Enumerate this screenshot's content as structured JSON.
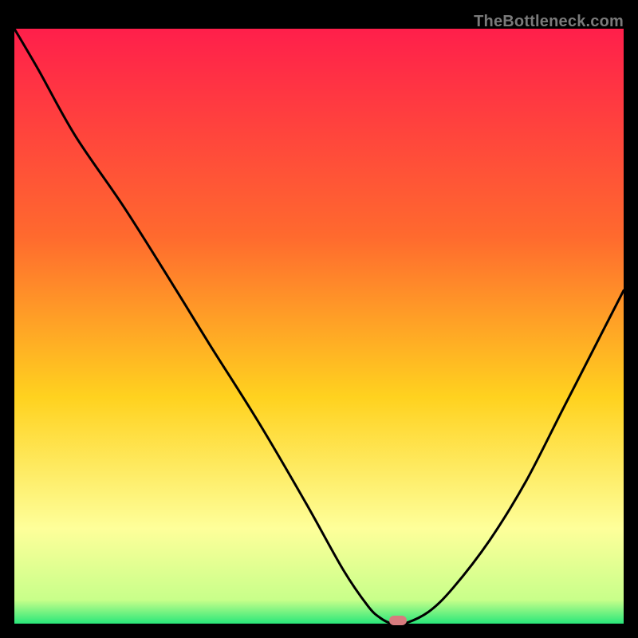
{
  "watermark": "TheBottleneck.com",
  "colors": {
    "top": "#ff1f4b",
    "mid1": "#ff6a2e",
    "mid2": "#ffd21f",
    "band": "#feff9a",
    "bottom": "#29e77a",
    "marker": "#d87b7e",
    "curve": "#000000",
    "frame": "#000000"
  },
  "chart_data": {
    "type": "line",
    "title": "",
    "xlabel": "",
    "ylabel": "",
    "xlim": [
      0,
      100
    ],
    "ylim": [
      0,
      100
    ],
    "series": [
      {
        "name": "bottleneck-curve",
        "x": [
          0,
          4,
          10,
          18,
          26,
          32,
          40,
          48,
          54,
          58,
          60,
          62,
          64,
          68,
          72,
          78,
          84,
          90,
          96,
          100
        ],
        "y": [
          100,
          93,
          82,
          70,
          57,
          47,
          34,
          20,
          9,
          3,
          1,
          0,
          0,
          2,
          6,
          14,
          24,
          36,
          48,
          56
        ]
      }
    ],
    "marker": {
      "x": 63,
      "y": 0.5
    },
    "gradient_stops": [
      {
        "offset": 0,
        "color": "#ff1f4b"
      },
      {
        "offset": 35,
        "color": "#ff6a2e"
      },
      {
        "offset": 62,
        "color": "#ffd21f"
      },
      {
        "offset": 84,
        "color": "#feff9a"
      },
      {
        "offset": 96,
        "color": "#c8ff8a"
      },
      {
        "offset": 100,
        "color": "#29e77a"
      }
    ]
  }
}
